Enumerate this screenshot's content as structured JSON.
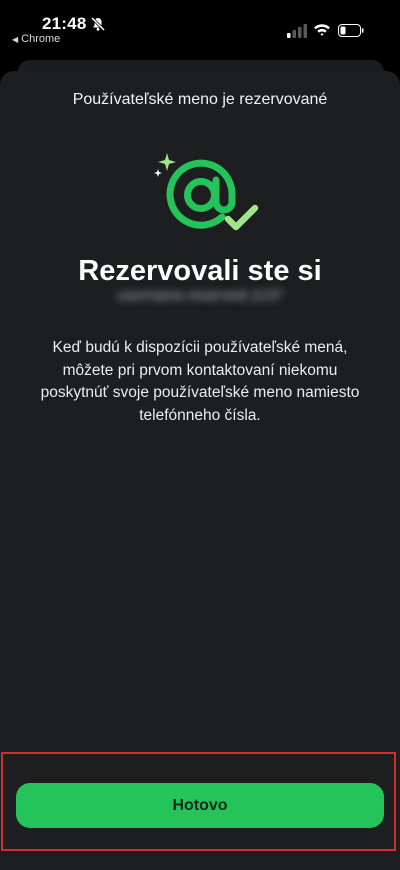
{
  "status_bar": {
    "time": "21:48",
    "back_app": "Chrome",
    "icons": [
      "bell-slash-icon",
      "signal-icon",
      "wifi-icon",
      "battery-icon"
    ]
  },
  "sheet": {
    "title": "Používateľské meno je rezervované",
    "icon": "at-sign-check-icon",
    "headline": "Rezervovali ste si",
    "username_obscured": "username.reserved.1137",
    "description": "Keď budú k dispozícii používateľské mená, môžete pri prvom kontaktovaní niekomu poskytnúť svoje používateľské meno namiesto telefónneho čísla.",
    "done_label": "Hotovo"
  },
  "colors": {
    "accent_green": "#25c45a",
    "icon_light_green": "#a3e48b",
    "sheet_bg": "#1c1e1f",
    "highlight_border": "#d32d2d"
  }
}
